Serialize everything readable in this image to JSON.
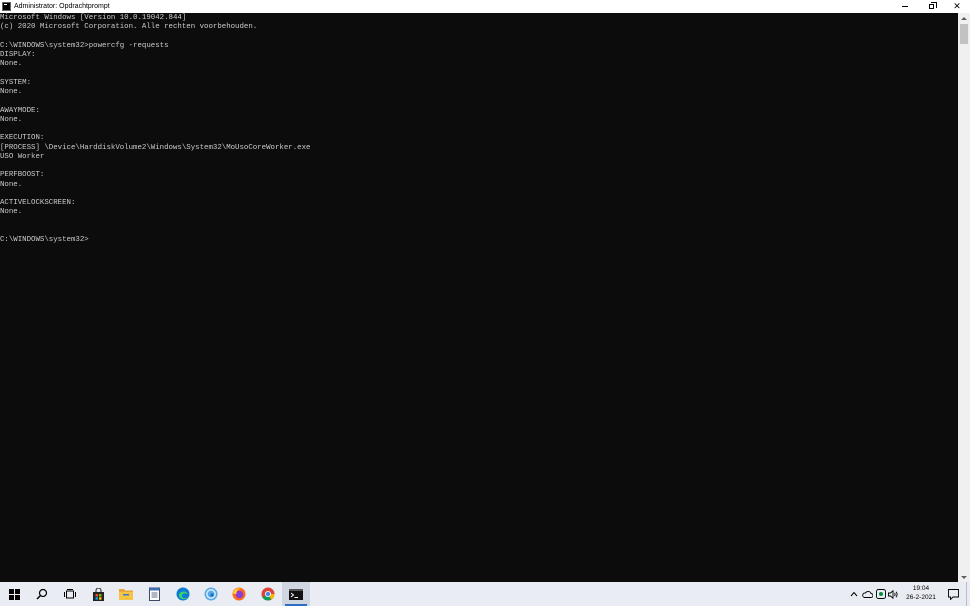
{
  "window": {
    "title": "Administrator: Opdrachtprompt",
    "icon": "cmd-icon"
  },
  "console": {
    "lines": [
      "Microsoft Windows [Version 10.0.19042.844]",
      "(c) 2020 Microsoft Corporation. Alle rechten voorbehouden.",
      "",
      "C:\\WINDOWS\\system32>powercfg -requests",
      "DISPLAY:",
      "None.",
      "",
      "SYSTEM:",
      "None.",
      "",
      "AWAYMODE:",
      "None.",
      "",
      "EXECUTION:",
      "[PROCESS] \\Device\\HarddiskVolume2\\Windows\\System32\\MoUsoCoreWorker.exe",
      "USO Worker",
      "",
      "PERFBOOST:",
      "None.",
      "",
      "ACTIVELOCKSCREEN:",
      "None.",
      "",
      "",
      "C:\\WINDOWS\\system32>"
    ],
    "text_color": "#cccccc",
    "background": "#0c0c0c"
  },
  "taskbar": {
    "pinned": [
      {
        "name": "start-icon"
      },
      {
        "name": "search-icon"
      },
      {
        "name": "task-view-icon"
      },
      {
        "name": "store-icon"
      },
      {
        "name": "file-explorer-icon"
      },
      {
        "name": "notepad-icon"
      },
      {
        "name": "edge-icon"
      },
      {
        "name": "edge-beta-icon"
      },
      {
        "name": "firefox-icon"
      },
      {
        "name": "chrome-icon"
      },
      {
        "name": "cmd-icon",
        "active": true
      }
    ],
    "tray": [
      "chevron-up-icon",
      "onedrive-icon",
      "defender-icon",
      "volume-icon"
    ],
    "clock": {
      "time": "19:04",
      "date": "26-2-2021"
    },
    "accent": "#2b6cc4"
  }
}
